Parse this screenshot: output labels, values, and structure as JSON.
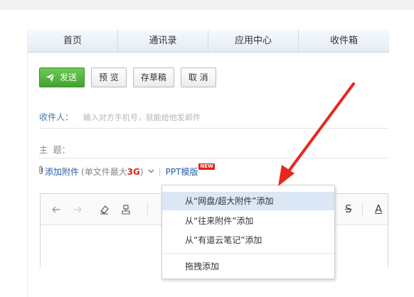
{
  "nav": {
    "tabs": [
      "首页",
      "通讯录",
      "应用中心",
      "收件箱"
    ]
  },
  "toolbar": {
    "send": "发送",
    "preview": "预 览",
    "draft": "存草稿",
    "cancel": "取 消"
  },
  "fields": {
    "recipient_label": "收件人：",
    "recipient_placeholder": "输入对方手机号，就能给他发邮件",
    "subject_label": "主  题："
  },
  "attach": {
    "label": "添加附件",
    "limit_prefix": "(单文件最大",
    "limit_size": "3G",
    "limit_suffix": ")",
    "ppt_label": "PPT模版",
    "new_badge": "NEW"
  },
  "dropdown": {
    "items": [
      "从“网盘/超大附件”添加",
      "从“往来附件”添加",
      "从“有道云笔记”添加",
      "拖拽添加"
    ],
    "selected_index": 0
  },
  "editor": {
    "font_color_glyph": "A",
    "strike_glyph": "S"
  },
  "icons": {
    "send": "paper-plane-icon",
    "clip": "paperclip-icon",
    "undo": "undo-icon",
    "redo": "redo-icon",
    "eraser": "eraser-icon",
    "format_brush": "format-brush-icon"
  },
  "colors": {
    "send_button": "#4cad36",
    "link": "#2a5da7",
    "arrow": "#e8281e",
    "dropdown_highlight": "#dbe7f5",
    "field_label": "#4a76a8"
  }
}
